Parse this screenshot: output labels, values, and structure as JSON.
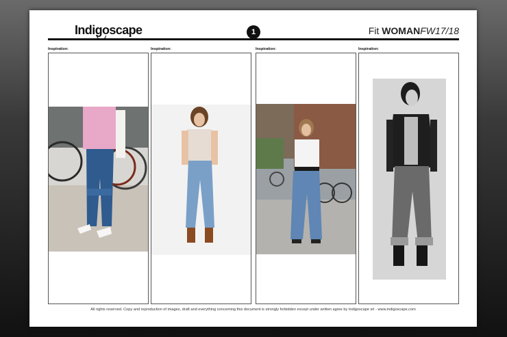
{
  "header": {
    "logo": "Indigoscape",
    "page_number": "1",
    "title_prefix": "Fit ",
    "title_bold": "WOMAN",
    "title_italic": "FW17/18"
  },
  "panels": [
    {
      "label": "Inspiration:"
    },
    {
      "label": "Inspiration:"
    },
    {
      "label": "Inspiration:"
    },
    {
      "label": "Inspiration:"
    }
  ],
  "footer": "All rights reserved. Copy and reproduction of images, draft and everything concerning this document is strongly forbidden except under written agree by Indigoscape srl - www.indigoscape.com",
  "colors": {
    "ink": "#111111",
    "denim_dark": "#2f4f7f",
    "denim_light": "#7aa0c8",
    "pink": "#e8a8c8",
    "leather": "#8a4a22"
  }
}
